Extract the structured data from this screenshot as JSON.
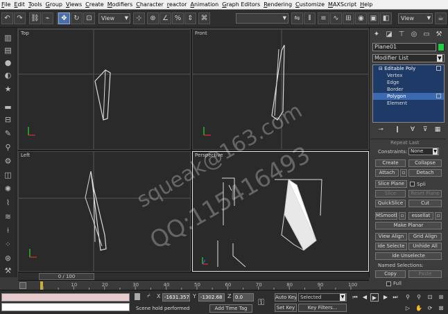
{
  "menubar": {
    "items": [
      {
        "u": "F",
        "rest": "ile"
      },
      {
        "u": "E",
        "rest": "dit"
      },
      {
        "u": "T",
        "rest": "ools"
      },
      {
        "u": "G",
        "rest": "roup"
      },
      {
        "u": "V",
        "rest": "iews"
      },
      {
        "u": "C",
        "rest": "reate"
      },
      {
        "u": "M",
        "rest": "odifiers"
      },
      {
        "u": "C",
        "rest": "haracter"
      },
      {
        "u": "r",
        "rest": "eactor"
      },
      {
        "u": "A",
        "rest": "nimation"
      },
      {
        "u": "G",
        "rest": "raph Editors"
      },
      {
        "u": "R",
        "rest": "endering"
      },
      {
        "u": "C",
        "rest": "ustomize"
      },
      {
        "u": "M",
        "rest": "AXScript"
      },
      {
        "u": "H",
        "rest": "elp"
      }
    ]
  },
  "toolbar": {
    "ref_coord": "View",
    "named_sel": "",
    "view_combo": "View"
  },
  "viewports": {
    "top": "Top",
    "front": "Front",
    "left": "Left",
    "perspective": "Perspective"
  },
  "cmdpanel": {
    "object_name": "Plane01",
    "object_color": "#22cc44",
    "modifier_list": "Modifier List",
    "stack": {
      "editable_poly": "Editable Poly",
      "vertex": "Vertex",
      "edge": "Edge",
      "border": "Border",
      "polygon": "Polygon",
      "element": "Element"
    },
    "rollout": {
      "repeat_last": "Repeat Last",
      "constraints_label": "Constraints:",
      "constraints_value": "None",
      "create": "Create",
      "collapse": "Collapse",
      "attach": "Attach",
      "detach": "Detach",
      "slice_plane": "Slice Plane",
      "split": "Spli",
      "slice": "Slice",
      "reset_plane": "Reset Plane",
      "quickslice": "QuickSlice",
      "cut": "Cut",
      "msmooth": "MSmooth",
      "tessellate": "essellat",
      "make_planar": "Make Planar",
      "view_align": "View Align",
      "grid_align": "Grid Align",
      "hide_selected": "ide Selecte",
      "unhide_all": "Unhide All",
      "hide_unselected": "ide Unselecte",
      "named_selections": "Named Selections:",
      "copy": "Copy",
      "paste": "Paste",
      "full": "Full"
    }
  },
  "trackbar": {
    "frame_slider": "0 / 100"
  },
  "timeline": {
    "ticks": [
      "10",
      "20",
      "30",
      "40",
      "50",
      "60",
      "70",
      "80",
      "90",
      "100"
    ]
  },
  "statusbar": {
    "x_label": "X",
    "x_value": "-1631.357",
    "y_label": "Y",
    "y_value": "-1302.68",
    "z_label": "Z",
    "z_value": "0.0",
    "prompt": "Scene hold performed",
    "add_time_tag": "Add Time Tag",
    "auto_key": "Auto Key",
    "auto_key_mode": "Selected",
    "set_key": "Set Key",
    "key_filters": "Key Filters..."
  },
  "watermark": {
    "line1": "squeak@163.com",
    "line2": "QQ:115416493"
  }
}
